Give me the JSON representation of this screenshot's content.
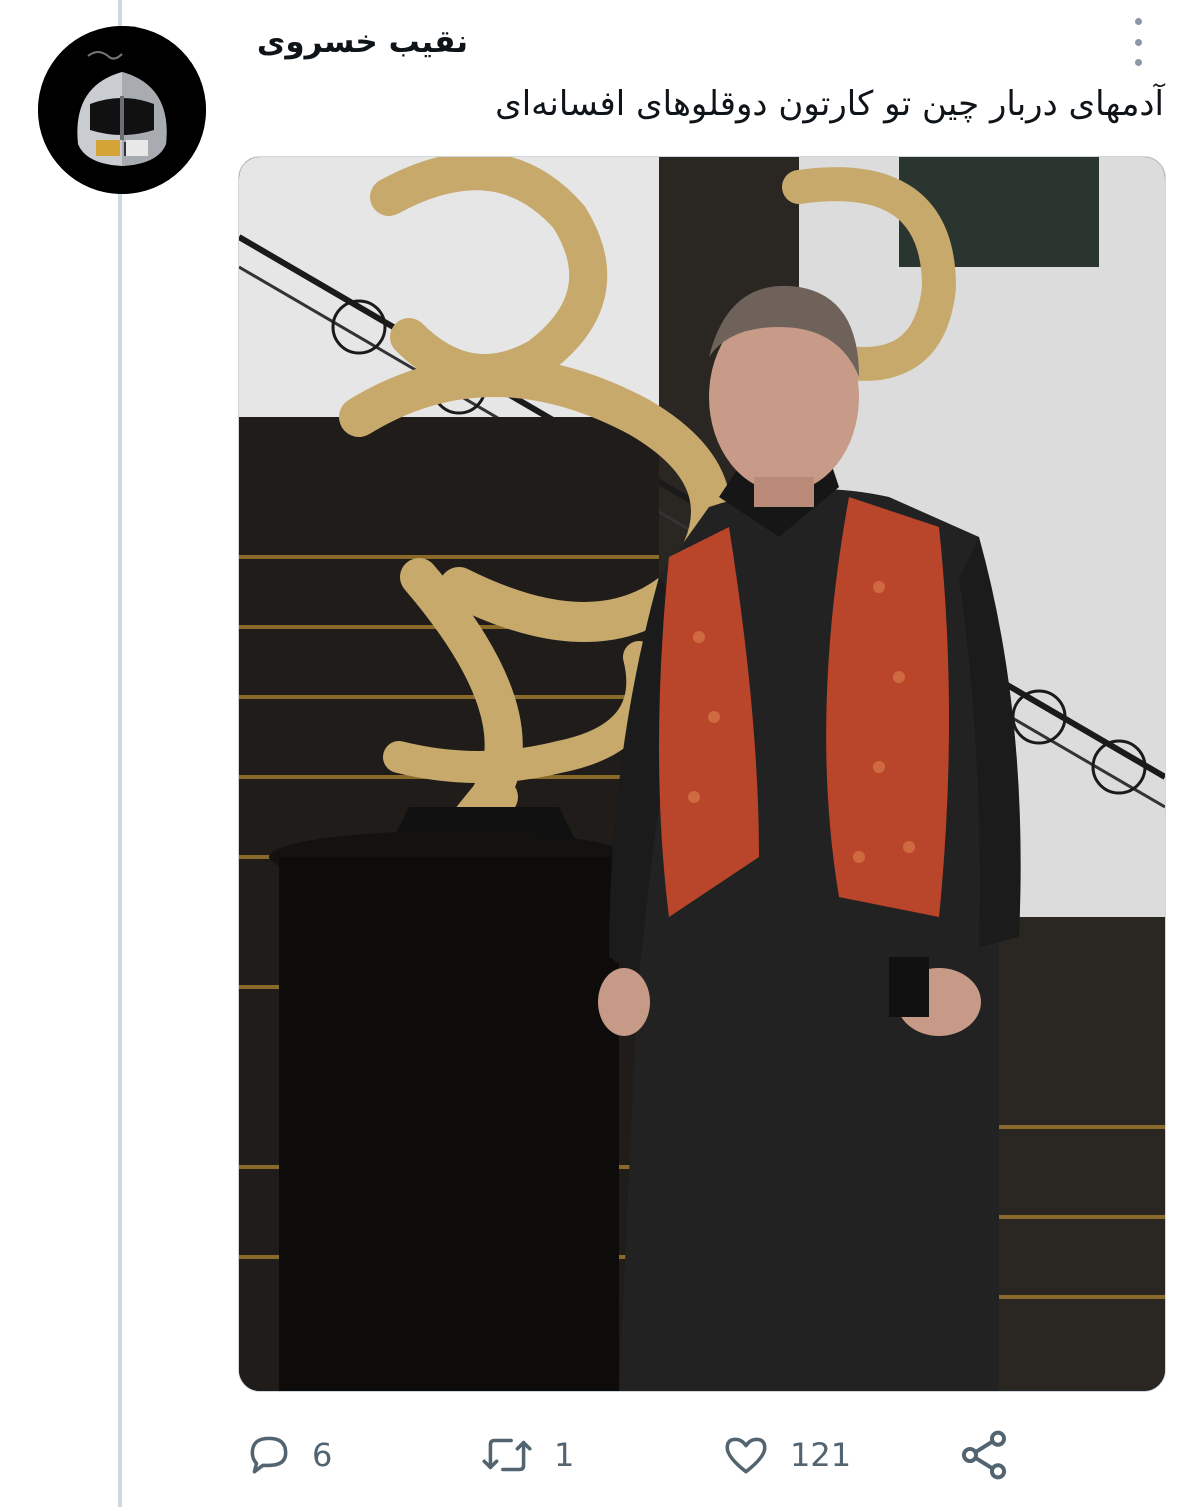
{
  "tweet": {
    "author_name": "نقیب خسروی",
    "text": "آدمهای دربار چین تو کارتون دوقلوهای افسانه‌ای",
    "avatar_icon": "helmet-avatar-icon",
    "more_icon": "more-options-icon",
    "media": {
      "description_icon": "photo-man-in-vest-icon"
    },
    "actions": {
      "reply": {
        "icon": "reply-icon",
        "count": "6"
      },
      "retweet": {
        "icon": "retweet-icon",
        "count": "1"
      },
      "like": {
        "icon": "like-icon",
        "count": "121"
      },
      "share": {
        "icon": "share-icon"
      }
    }
  },
  "colors": {
    "icon_gray": "#536471",
    "thread_line": "#cfd9de",
    "text": "#0f1419"
  }
}
